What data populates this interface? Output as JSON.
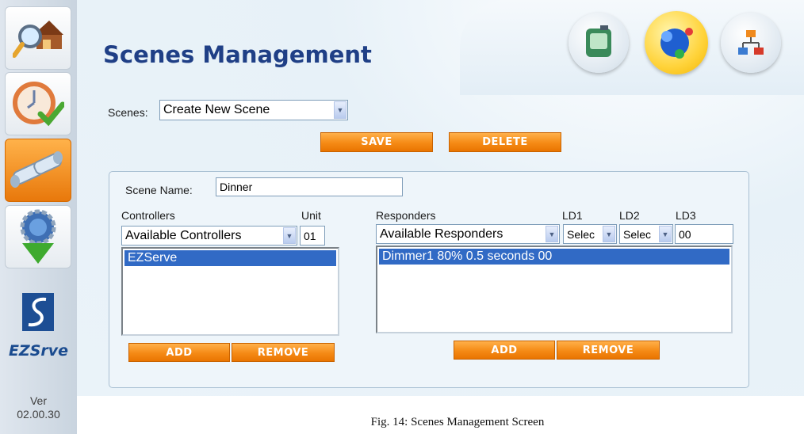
{
  "sidebar": {
    "items": [
      {
        "icon": "house-search-icon"
      },
      {
        "icon": "clock-check-icon"
      },
      {
        "icon": "pipes-icon"
      },
      {
        "icon": "globe-download-icon"
      }
    ],
    "brand": "EZSrve",
    "version_label": "Ver",
    "version": "02.00.30"
  },
  "header": {
    "title": "Scenes Management",
    "top_icons": [
      "device-icon",
      "network-nodes-icon",
      "hierarchy-icon"
    ]
  },
  "scenes": {
    "label": "Scenes:",
    "selected": "Create New Scene"
  },
  "actions": {
    "save_label": "SAVE",
    "delete_label": "DELETE"
  },
  "scene_form": {
    "name_label": "Scene Name:",
    "name_value": "Dinner",
    "controllers": {
      "label": "Controllers",
      "unit_label": "Unit",
      "select_value": "Available Controllers",
      "unit_value": "01",
      "items": [
        "EZServe"
      ],
      "add_label": "ADD",
      "remove_label": "REMOVE"
    },
    "responders": {
      "label": "Responders",
      "ld1_label": "LD1",
      "ld2_label": "LD2",
      "ld3_label": "LD3",
      "select_value": "Available Responders",
      "ld1_value": "Selec",
      "ld2_value": "Selec",
      "ld3_value": "00",
      "items": [
        "Dimmer1 80% 0.5 seconds 00"
      ],
      "add_label": "ADD",
      "remove_label": "REMOVE"
    }
  },
  "caption": "Fig. 14: Scenes Management Screen",
  "colors": {
    "title": "#1f3f86",
    "accent": "#f58a15",
    "selection": "#316ac5"
  }
}
